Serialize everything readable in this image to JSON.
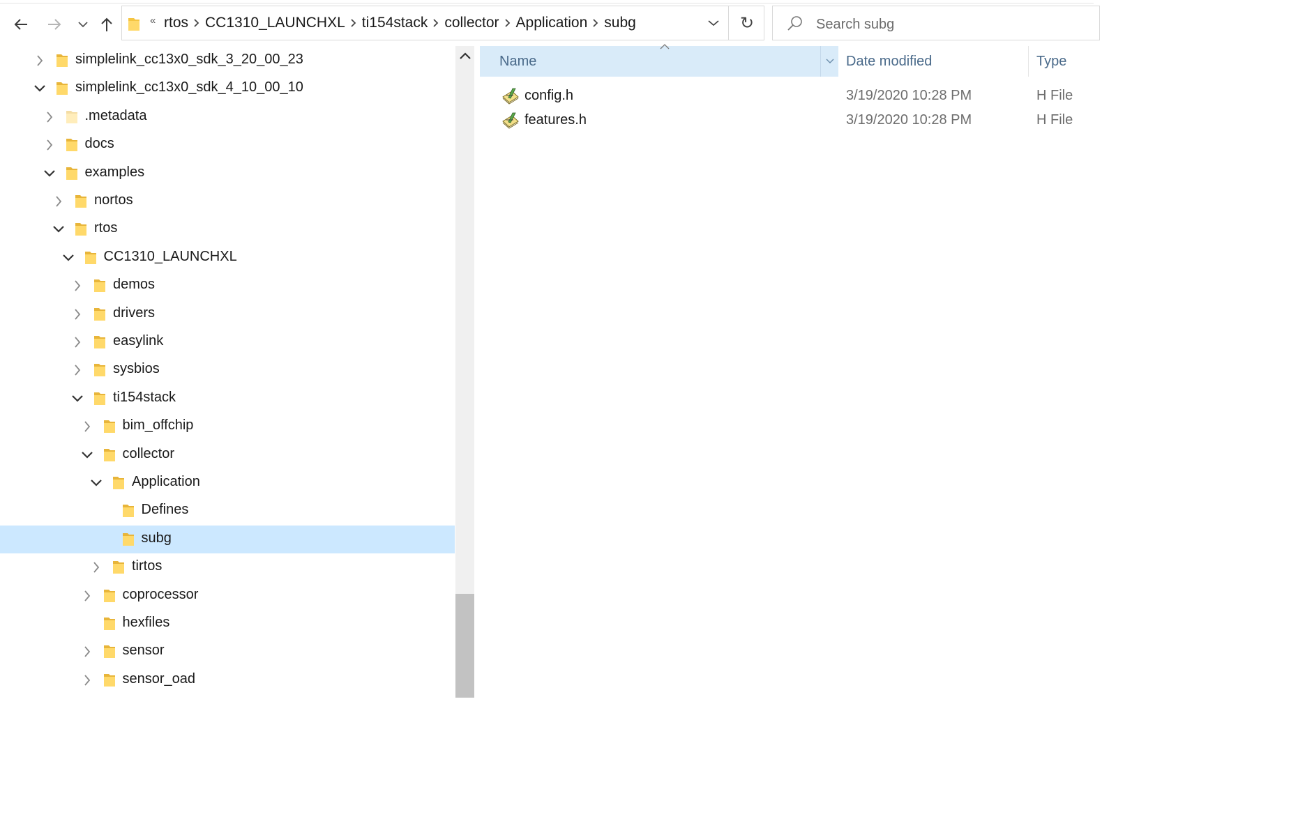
{
  "nav": {
    "back": "back-arrow",
    "forward": "forward-arrow",
    "recent": "chevron-down",
    "up": "up-arrow"
  },
  "address": {
    "overflow": "«",
    "crumbs": [
      "rtos",
      "CC1310_LAUNCHXL",
      "ti154stack",
      "collector",
      "Application",
      "subg"
    ],
    "refresh_glyph": "↻"
  },
  "search": {
    "placeholder": "Search subg"
  },
  "tree": [
    {
      "label": "simplelink_cc13x0_sdk_3_20_00_23",
      "depth": 0,
      "expander": "collapsed",
      "selected": false
    },
    {
      "label": "simplelink_cc13x0_sdk_4_10_00_10",
      "depth": 0,
      "expander": "expanded",
      "selected": false
    },
    {
      "label": ".metadata",
      "depth": 1,
      "expander": "collapsed",
      "selected": false,
      "faded": true
    },
    {
      "label": "docs",
      "depth": 1,
      "expander": "collapsed",
      "selected": false
    },
    {
      "label": "examples",
      "depth": 1,
      "expander": "expanded",
      "selected": false
    },
    {
      "label": "nortos",
      "depth": 2,
      "expander": "collapsed",
      "selected": false
    },
    {
      "label": "rtos",
      "depth": 2,
      "expander": "expanded",
      "selected": false
    },
    {
      "label": "CC1310_LAUNCHXL",
      "depth": 3,
      "expander": "expanded",
      "selected": false
    },
    {
      "label": "demos",
      "depth": 4,
      "expander": "collapsed",
      "selected": false
    },
    {
      "label": "drivers",
      "depth": 4,
      "expander": "collapsed",
      "selected": false
    },
    {
      "label": "easylink",
      "depth": 4,
      "expander": "collapsed",
      "selected": false
    },
    {
      "label": "sysbios",
      "depth": 4,
      "expander": "collapsed",
      "selected": false
    },
    {
      "label": "ti154stack",
      "depth": 4,
      "expander": "expanded",
      "selected": false
    },
    {
      "label": "bim_offchip",
      "depth": 5,
      "expander": "collapsed",
      "selected": false
    },
    {
      "label": "collector",
      "depth": 5,
      "expander": "expanded",
      "selected": false
    },
    {
      "label": "Application",
      "depth": 6,
      "expander": "expanded",
      "selected": false
    },
    {
      "label": "Defines",
      "depth": 7,
      "expander": "none",
      "selected": false
    },
    {
      "label": "subg",
      "depth": 7,
      "expander": "none",
      "selected": true
    },
    {
      "label": "tirtos",
      "depth": 6,
      "expander": "collapsed",
      "selected": false
    },
    {
      "label": "coprocessor",
      "depth": 5,
      "expander": "collapsed",
      "selected": false
    },
    {
      "label": "hexfiles",
      "depth": 5,
      "expander": "none",
      "selected": false
    },
    {
      "label": "sensor",
      "depth": 5,
      "expander": "collapsed",
      "selected": false
    },
    {
      "label": "sensor_oad",
      "depth": 5,
      "expander": "collapsed",
      "selected": false
    }
  ],
  "columns": {
    "name": "Name",
    "date": "Date modified",
    "type": "Type"
  },
  "files": [
    {
      "name": "config.h",
      "date": "3/19/2020 10:28 PM",
      "type": "H File",
      "icon": "h-file-icon"
    },
    {
      "name": "features.h",
      "date": "3/19/2020 10:28 PM",
      "type": "H File",
      "icon": "h-file-icon"
    }
  ],
  "colors": {
    "selection": "#cce8ff",
    "header_selected": "#d9ebf9",
    "folder": "#f5c542",
    "scroll_thumb": "#c2c2c2"
  }
}
